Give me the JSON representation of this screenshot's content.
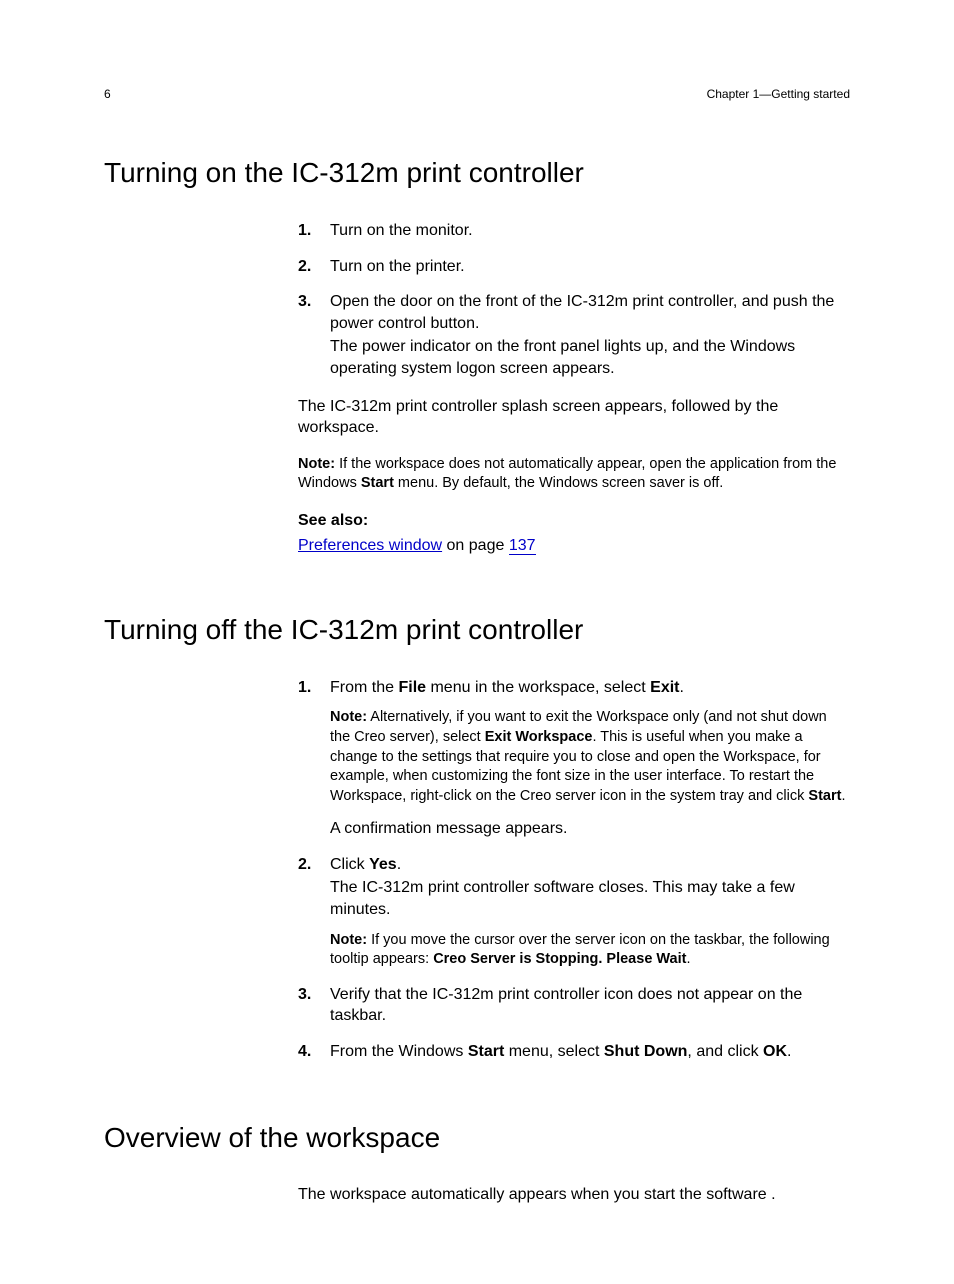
{
  "header": {
    "page_number": "6",
    "chapter": "Chapter 1—Getting started"
  },
  "section1": {
    "title": "Turning on the IC-312m print controller",
    "steps": [
      {
        "n": "1.",
        "lines": [
          "Turn on the monitor."
        ]
      },
      {
        "n": "2.",
        "lines": [
          "Turn on the printer."
        ]
      },
      {
        "n": "3.",
        "lines": [
          "Open the door on the front of the IC-312m print controller, and push the power control button.",
          "The power indicator on the front panel lights up, and the Windows operating system logon screen appears."
        ]
      }
    ],
    "after_steps": "The IC-312m print controller splash screen appears, followed by the workspace.",
    "note_prefix": "Note:",
    "note_text_1a": " If the workspace does not automatically appear, open the application from the Windows ",
    "note_bold_1": "Start",
    "note_text_1b": " menu. By default, the Windows screen saver is off.",
    "see_also_label": "See also:",
    "see_also_link": "Preferences window",
    "see_also_mid": " on page ",
    "see_also_page": "137"
  },
  "section2": {
    "title": "Turning off the IC-312m print controller",
    "step1": {
      "n": "1.",
      "text_a": "From the ",
      "bold_a": "File",
      "text_b": " menu in the workspace, select ",
      "bold_b": "Exit",
      "text_c": ".",
      "note_prefix": "Note:",
      "note_a": " Alternatively, if you want to exit the Workspace only (and not shut down the Creo server), select ",
      "note_bold": "Exit Workspace",
      "note_b": ". This is useful when you make a change to the settings that require you to close and open the Workspace, for example, when customizing the font size in the user interface. To restart the Workspace, right-click on the Creo server icon in the system tray and click ",
      "note_bold2": "Start",
      "note_c": ".",
      "after": "A confirmation message appears."
    },
    "step2": {
      "n": "2.",
      "text_a": "Click ",
      "bold_a": "Yes",
      "text_b": ".",
      "line2": "The IC-312m print controller software closes. This may take a few minutes.",
      "note_prefix": "Note:",
      "note_a": " If you move the cursor over the server icon on the taskbar, the following tooltip appears: ",
      "note_bold": "Creo Server is Stopping. Please Wait",
      "note_b": "."
    },
    "step3": {
      "n": "3.",
      "text": "Verify that the IC-312m print controller icon does not appear on the taskbar."
    },
    "step4": {
      "n": "4.",
      "text_a": "From the Windows ",
      "bold_a": "Start",
      "text_b": " menu, select ",
      "bold_b": "Shut Down",
      "text_c": ", and click ",
      "bold_c": "OK",
      "text_d": "."
    }
  },
  "section3": {
    "title": "Overview of the workspace",
    "para": "The workspace automatically appears when you start the software ."
  }
}
